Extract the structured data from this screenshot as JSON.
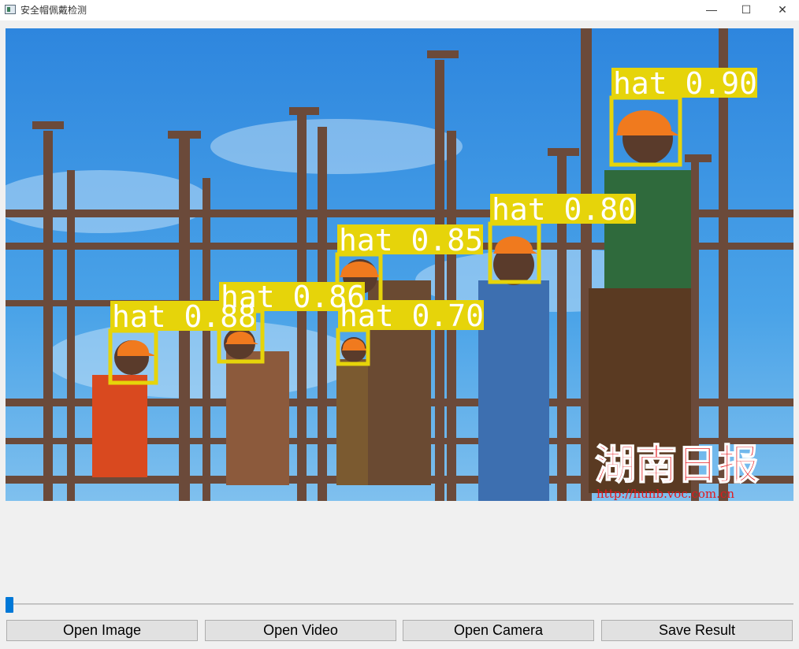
{
  "window": {
    "title": "安全帽佩戴检测",
    "minimize_glyph": "—",
    "maximize_glyph": "☐",
    "close_glyph": "✕"
  },
  "detections": [
    {
      "label": "hat 0.90",
      "confidence": 0.9
    },
    {
      "label": "hat 0.80",
      "confidence": 0.8
    },
    {
      "label": "hat 0.85",
      "confidence": 0.85
    },
    {
      "label": "hat 0.86",
      "confidence": 0.86
    },
    {
      "label": "hat 0.88",
      "confidence": 0.88
    },
    {
      "label": "hat 0.70",
      "confidence": 0.7
    }
  ],
  "watermark": {
    "text": "湖南日报",
    "url": "http://hunb.voc.com.cn"
  },
  "progress": {
    "value": 0
  },
  "buttons": {
    "open_image": "Open Image",
    "open_video": "Open Video",
    "open_camera": "Open Camera",
    "save_result": "Save Result"
  },
  "colors": {
    "detection_box": "#e6d40a",
    "slider_handle": "#0078d7",
    "watermark": "#e3171c"
  }
}
